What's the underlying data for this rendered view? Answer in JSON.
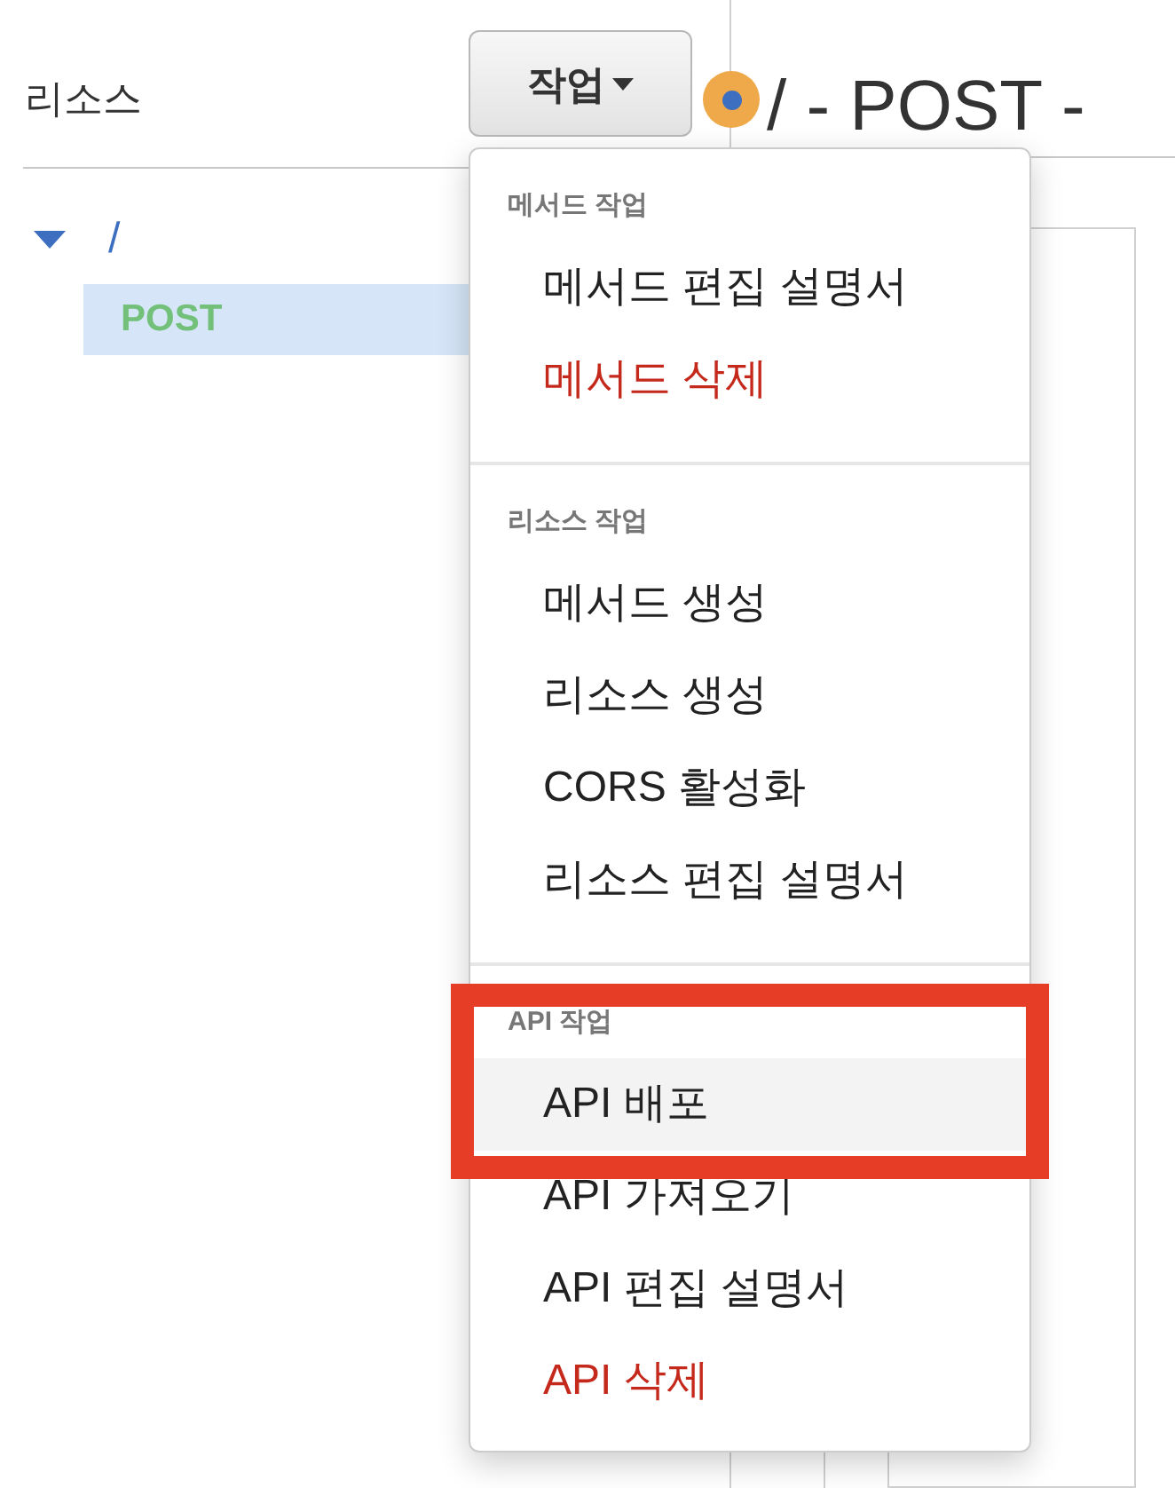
{
  "sidebar": {
    "title": "리소스",
    "tree": [
      {
        "label": "/",
        "expanded": true,
        "children": [
          {
            "label": "POST",
            "selected": true
          }
        ]
      }
    ]
  },
  "actions_button": {
    "label": "작업"
  },
  "header": {
    "title": "/ - POST -"
  },
  "actions_menu": {
    "sections": [
      {
        "title": "메서드 작업",
        "highlighted": false,
        "items": [
          {
            "label": "메서드 편집 설명서",
            "danger": false,
            "selected": false
          },
          {
            "label": "메서드 삭제",
            "danger": true,
            "selected": false
          }
        ]
      },
      {
        "title": "리소스 작업",
        "highlighted": false,
        "items": [
          {
            "label": "메서드 생성",
            "danger": false,
            "selected": false
          },
          {
            "label": "리소스 생성",
            "danger": false,
            "selected": false
          },
          {
            "label": "CORS 활성화",
            "danger": false,
            "selected": false
          },
          {
            "label": "리소스 편집 설명서",
            "danger": false,
            "selected": false
          }
        ]
      },
      {
        "title": "API 작업",
        "highlighted": true,
        "items": [
          {
            "label": "API 배포",
            "danger": false,
            "selected": true
          },
          {
            "label": "API 가져오기",
            "danger": false,
            "selected": false
          },
          {
            "label": "API 편집 설명서",
            "danger": false,
            "selected": false
          },
          {
            "label": "API 삭제",
            "danger": true,
            "selected": false
          }
        ]
      }
    ]
  }
}
